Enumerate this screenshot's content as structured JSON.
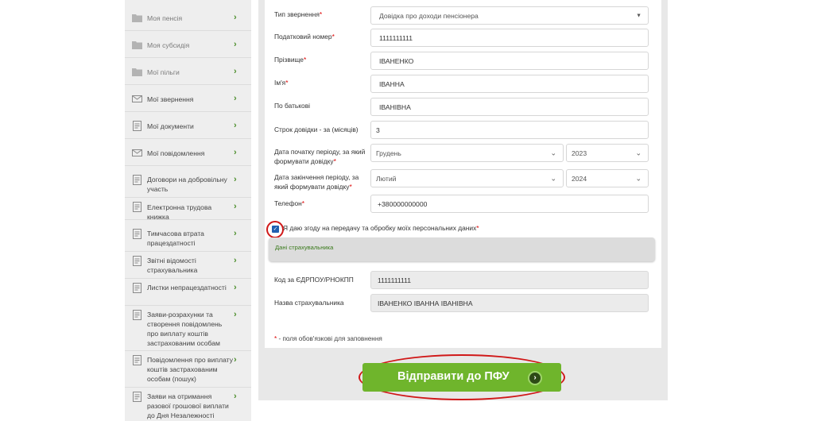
{
  "sidebar": {
    "items": [
      {
        "label": "Моя пенсія",
        "icon": "folder-icon"
      },
      {
        "label": "Моя субсидія",
        "icon": "folder-icon"
      },
      {
        "label": "Мої пільги",
        "icon": "folder-icon"
      },
      {
        "label": "Мої звернення",
        "icon": "envelope-icon"
      },
      {
        "label": "Мої документи",
        "icon": "document-icon"
      },
      {
        "label": "Мої повідомлення",
        "icon": "envelope-icon"
      },
      {
        "label": "Договори на добровільну участь",
        "icon": "document-icon"
      },
      {
        "label": "Електронна трудова книжка",
        "icon": "document-icon"
      },
      {
        "label": "Тимчасова втрата працездатності",
        "icon": "document-icon"
      },
      {
        "label": "Звітні відомості страхувальника",
        "icon": "document-icon"
      },
      {
        "label": "Листки непрацездатності",
        "icon": "document-icon"
      },
      {
        "label": "Заяви-розрахунки та створення повідомлень про виплату коштів застрахованим особам",
        "icon": "document-icon"
      },
      {
        "label": "Повідомлення про виплату коштів застрахованим особам (пошук)",
        "icon": "document-icon"
      },
      {
        "label": "Заяви на отримання разової грошової виплати до Дня Незалежності України",
        "icon": "document-icon"
      }
    ],
    "chevron": "›"
  },
  "form": {
    "request_type": {
      "label": "Тип звернення",
      "value": "Довідка про доходи пенсіонера"
    },
    "tax_number": {
      "label": "Податковий номер",
      "value": "1111111111"
    },
    "surname": {
      "label": "Прізвище",
      "value": "ІВАНЕНКО"
    },
    "name": {
      "label": "Ім'я",
      "value": "ІВАННА"
    },
    "patronymic": {
      "label": "По батькові",
      "value": "ІВАНІВНА"
    },
    "term": {
      "label": "Строк довідки - за (місяців)",
      "value": "3"
    },
    "period_start": {
      "label": "Дата початку періоду, за який формувати довідку",
      "month": "Грудень",
      "year": "2023"
    },
    "period_end": {
      "label": "Дата закінчення періоду, за який формувати довідку",
      "month": "Лютий",
      "year": "2024"
    },
    "phone": {
      "label": "Телефон",
      "value": "+380000000000"
    },
    "required_mark": "*",
    "consent_label": "Я даю згоду на передачу та обробку моїх персональних даних"
  },
  "insurer": {
    "title": "Дані страхувальника",
    "code": {
      "label": "Код за ЄДРПОУ/РНОКПП",
      "value": "1111111111"
    },
    "name": {
      "label": "Назва страхувальника",
      "value": "ІВАНЕНКО ІВАННА ІВАНІВНА"
    }
  },
  "note": {
    "star": "*",
    "text": " - поля обов'язкові для заповнення"
  },
  "submit": {
    "label": "Відправити до ПФУ",
    "arrow": "›"
  },
  "colors": {
    "accent": "#6fb52c",
    "highlight": "#d01818",
    "link": "#3a7a1c"
  }
}
